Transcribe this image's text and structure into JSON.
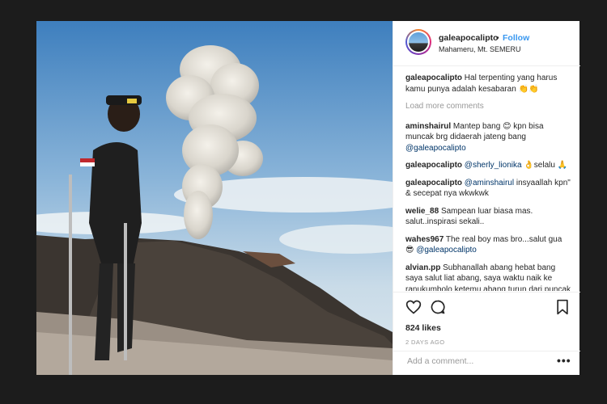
{
  "post": {
    "username": "galeapocalipto",
    "dot": "•",
    "follow_label": "Follow",
    "location": "Mahameru, Mt. SEMERU"
  },
  "caption": {
    "username": "galeapocalipto",
    "text": "Hal terpenting yang harus kamu punya adalah kesabaran 👏👏"
  },
  "load_more_label": "Load more comments",
  "comments": [
    {
      "user": "aminshairul",
      "text": "Mantep bang 😊 kpn bisa muncak brg didaerah jateng bang",
      "mention": "@galeapocalipto"
    },
    {
      "user": "galeapocalipto",
      "mention": "@sherly_lionika",
      "text": "👌selalu 🙏"
    },
    {
      "user": "galeapocalipto",
      "mention": "@aminshairul",
      "text": "insyaallah kpn\" & secepat nya wkwkwk"
    },
    {
      "user": "welie_88",
      "text": "Sampean luar biasa mas. salut..inspirasi sekali.."
    },
    {
      "user": "wahes967",
      "text": "The real boy mas bro...salut gua 😎",
      "mention": "@galeapocalipto"
    },
    {
      "user": "alvian.pp",
      "text": "Subhanallah abang hebat bang saya salut liat abang, saya waktu naik ke ranukumbolo ketemu abang turun dari puncak waktu di jembatan merah"
    }
  ],
  "likes": "824 likes",
  "age": "2 DAYS AGO",
  "add_comment_placeholder": "Add a comment...",
  "more_dots": "•••",
  "colors": {
    "follow": "#3897f0",
    "mention": "#003569",
    "muted": "#999999"
  },
  "icons": [
    "heart-icon",
    "comment-icon",
    "bookmark-icon"
  ]
}
